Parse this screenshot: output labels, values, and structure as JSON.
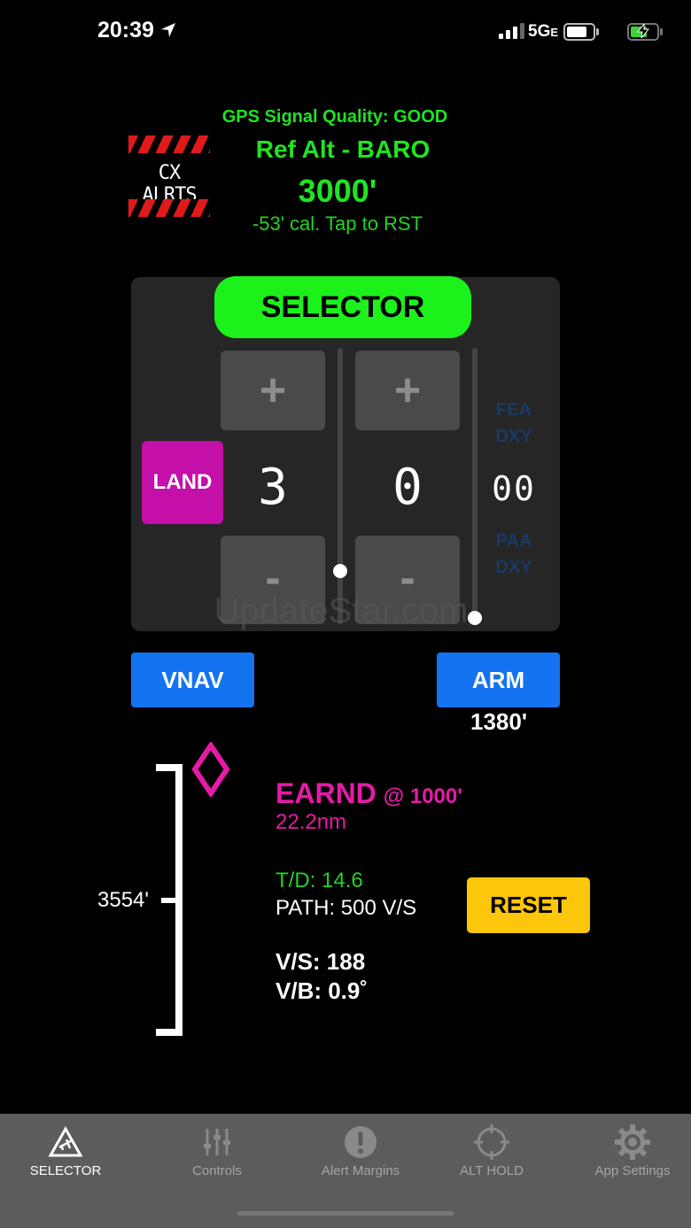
{
  "status": {
    "time": "20:39",
    "network": "5G",
    "network_suffix": "E",
    "location_icon": "location-arrow-icon",
    "battery2_icon": "charging-battery-icon"
  },
  "header": {
    "gps_quality": "GPS Signal Quality: GOOD",
    "ref_alt_label": "Ref Alt - BARO",
    "ref_alt_value": "3000'",
    "calibration": "-53' cal. Tap to RST",
    "logo_text": "CX ALRTS"
  },
  "selector": {
    "title": "SELECTOR",
    "mode": "LAND",
    "thousands": "3",
    "hundreds": "0",
    "fixed_digits": "00",
    "plus": "+",
    "minus": "-",
    "ghost_top": [
      "FEA",
      "DXY"
    ],
    "ghost_bottom": [
      "PAA",
      "DXY"
    ],
    "watermark": "UpdateStar.com"
  },
  "buttons": {
    "vnav": "VNAV",
    "arm": "ARM",
    "arm_altitude": "1380'",
    "reset": "RESET"
  },
  "vertical": {
    "current_alt": "3554'",
    "waypoint": "EARND",
    "waypoint_alt": "@ 1000'",
    "distance": "22.2nm",
    "top_of_descent": "T/D: 14.6",
    "path": "PATH: 500 V/S",
    "vertical_speed": "V/S: 188",
    "vertical_bearing": "V/B: 0.9˚"
  },
  "tabs": [
    {
      "label": "SELECTOR",
      "icon": "selector-icon",
      "active": true
    },
    {
      "label": "Controls",
      "icon": "sliders-icon",
      "active": false
    },
    {
      "label": "Alert Margins",
      "icon": "alert-icon",
      "active": false
    },
    {
      "label": "ALT HOLD",
      "icon": "crosshair-icon",
      "active": false
    },
    {
      "label": "App Settings",
      "icon": "gear-icon",
      "active": false
    }
  ],
  "colors": {
    "green": "#22e322",
    "magenta": "#e61aa6",
    "blue": "#1473f1",
    "yellow": "#fcc60a"
  }
}
